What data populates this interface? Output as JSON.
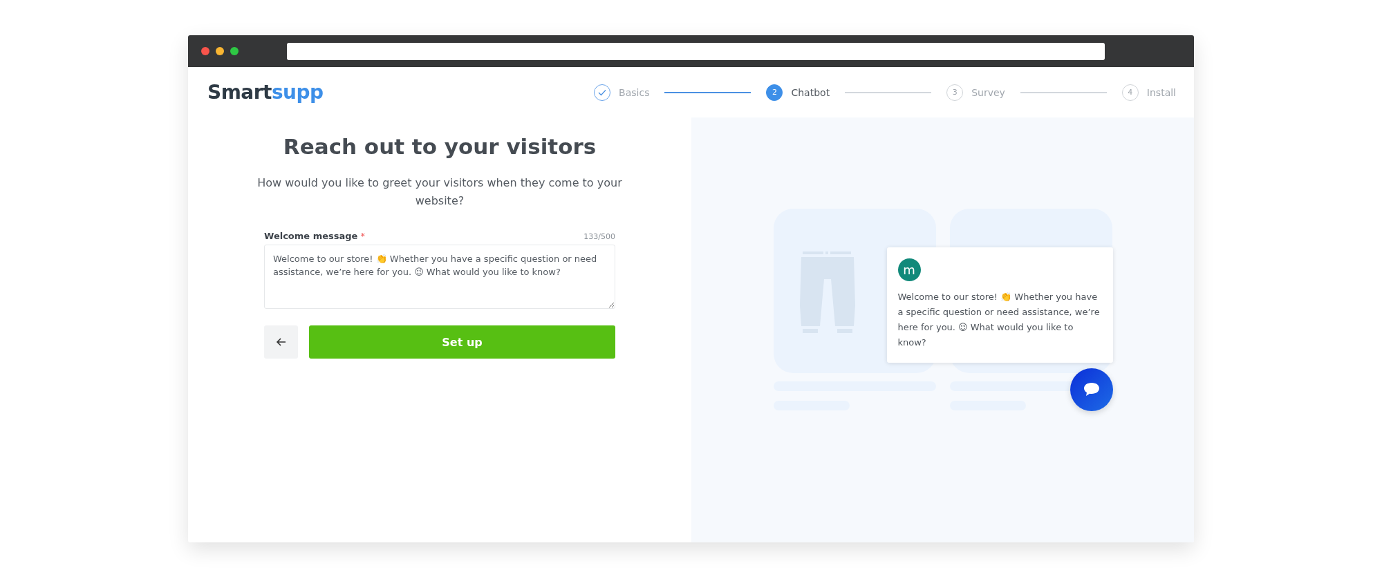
{
  "logo": {
    "dark": "Smart",
    "accent": "supp"
  },
  "steps": [
    {
      "label": "Basics",
      "completed": true,
      "selected": false
    },
    {
      "label": "Chatbot",
      "number": "2",
      "completed": false,
      "selected": true
    },
    {
      "label": "Survey",
      "number": "3",
      "completed": false,
      "selected": false
    },
    {
      "label": "Install",
      "number": "4",
      "completed": false,
      "selected": false
    }
  ],
  "form": {
    "title": "Reach out to your visitors",
    "subtitle": "How would you like to greet your visitors when they come to your website?",
    "field_label": "Welcome message",
    "required_mark": "*",
    "counter": "133/500",
    "value": "Welcome to our store! 👏 Whether you have a specific question or need assistance, we’re here for you. 😉 What would you like to know?",
    "submit": "Set up"
  },
  "preview": {
    "avatar": "m",
    "message": "Welcome to our store! 👏 Whether you have a specific question or need assistance, we’re here for you. 😉 What would you like to know?"
  }
}
